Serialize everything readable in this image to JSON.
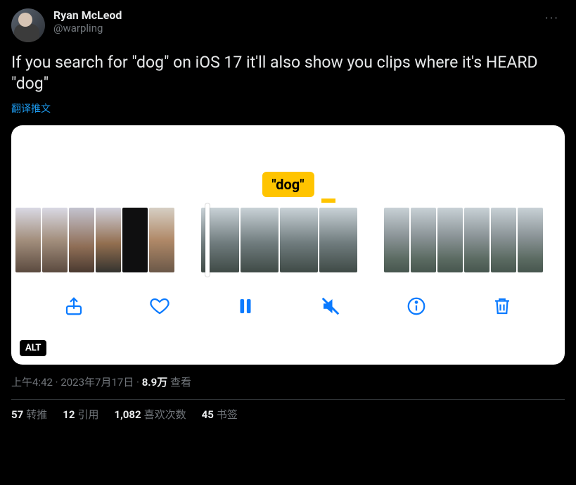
{
  "author": {
    "display_name": "Ryan McLeod",
    "handle": "@warpling"
  },
  "more_glyph": "···",
  "tweet_text": "If you search for \"dog\" on iOS 17 it'll also show you clips where it's HEARD \"dog\"",
  "translate_label": "翻译推文",
  "media": {
    "search_pill": "\"dog\"",
    "alt_badge": "ALT"
  },
  "meta": {
    "time": "上午4:42",
    "sep1": " · ",
    "date": "2023年7月17日",
    "sep2": " · ",
    "views_num": "8.9万",
    "views_label": " 查看"
  },
  "stats": {
    "retweets_num": "57",
    "retweets_label": "转推",
    "quotes_num": "12",
    "quotes_label": "引用",
    "likes_num": "1,082",
    "likes_label": "喜欢次数",
    "bookmarks_num": "45",
    "bookmarks_label": "书签"
  }
}
